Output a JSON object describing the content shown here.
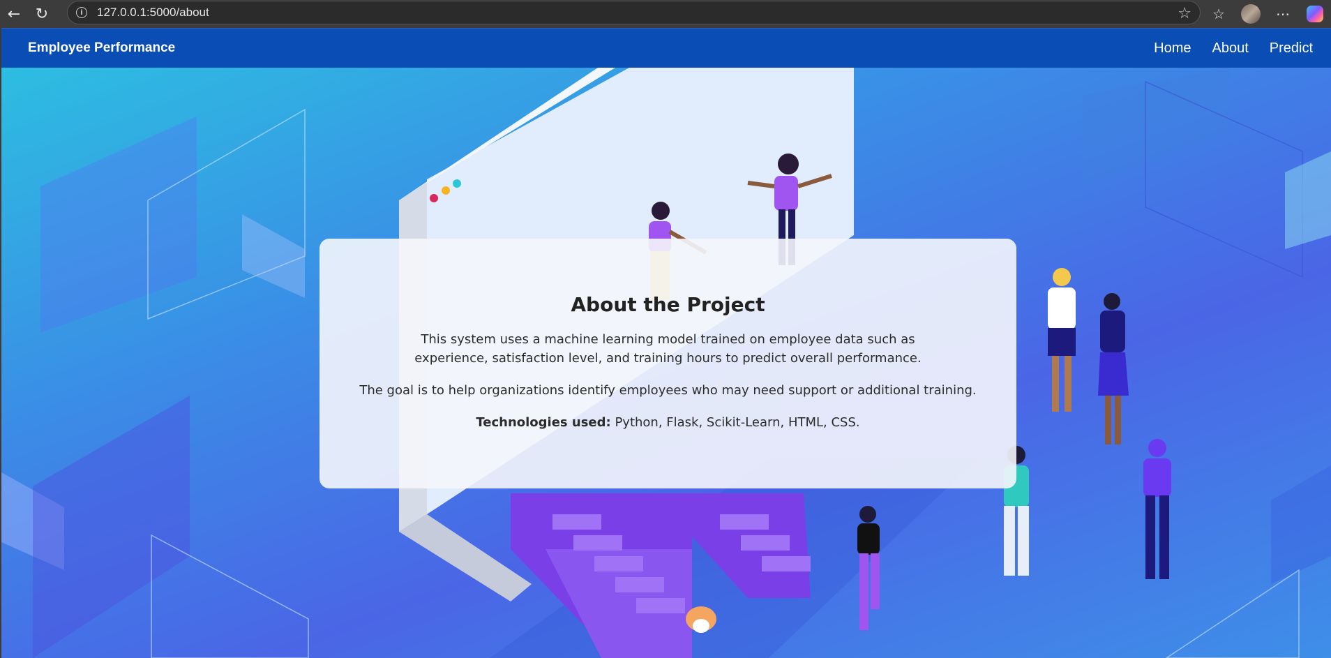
{
  "browser": {
    "url": "127.0.0.1:5000/about",
    "icons": [
      "back-arrow-icon",
      "refresh-icon",
      "info-icon",
      "star-icon",
      "favorites-icon",
      "more-icon"
    ]
  },
  "navbar": {
    "brand": "Employee Performance",
    "links": [
      "Home",
      "About",
      "Predict"
    ]
  },
  "card": {
    "title": "About the Project",
    "paragraph1": "This system uses a machine learning model trained on employee data such as experience, satisfaction level, and training hours to predict overall performance.",
    "paragraph2": "The goal is to help organizations identify employees who may need support or additional training.",
    "tech_label": "Technologies used:",
    "tech_value": " Python, Flask, Scikit-Learn, HTML, CSS."
  },
  "colors": {
    "navbar": "#0a4db5",
    "card_bg": "#f5f6fc"
  }
}
